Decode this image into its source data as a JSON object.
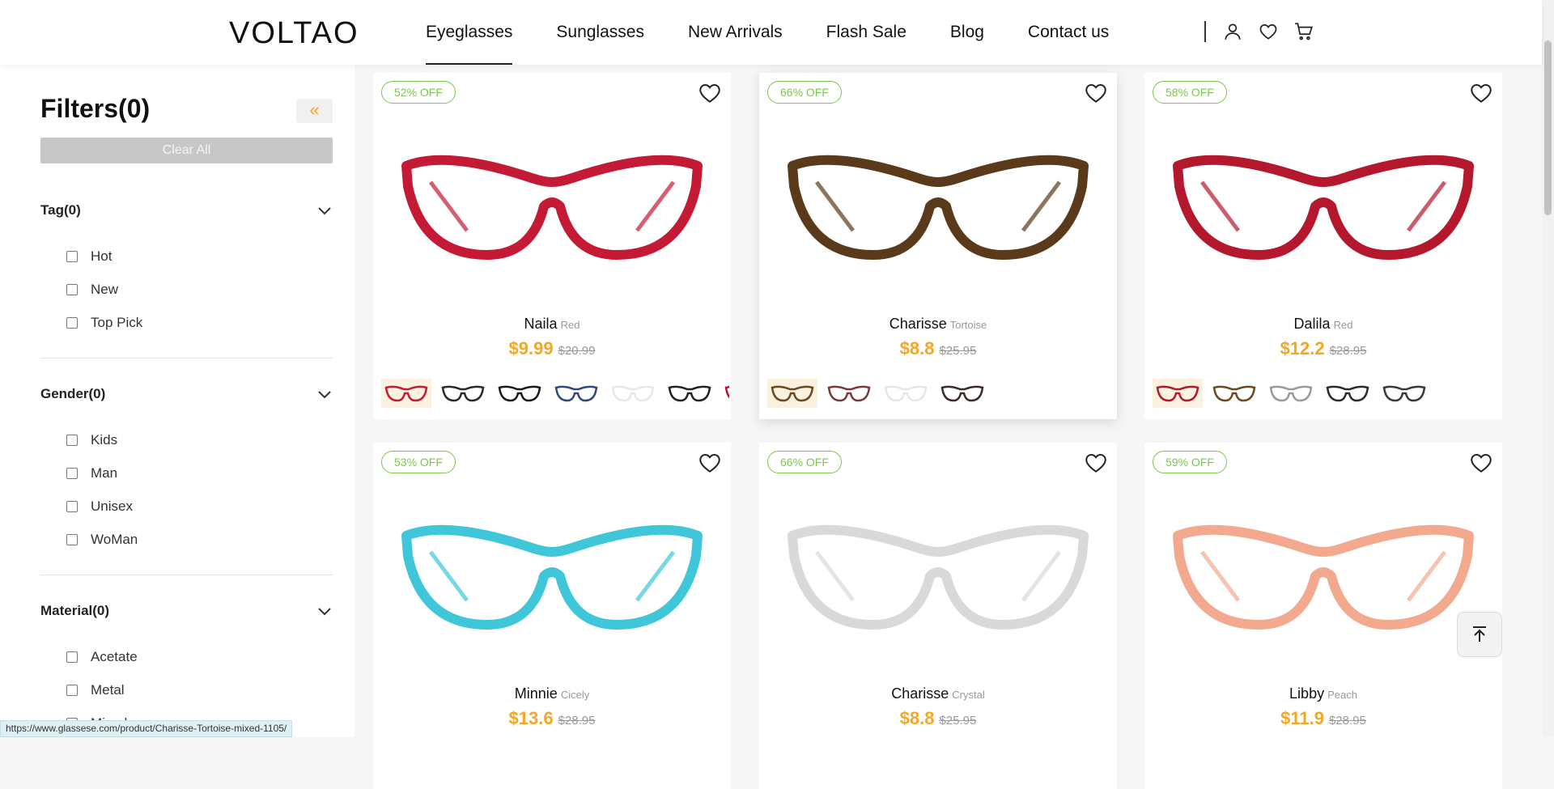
{
  "header": {
    "logo": "VOLTAO",
    "nav": [
      "Eyeglasses",
      "Sunglasses",
      "New Arrivals",
      "Flash Sale",
      "Blog",
      "Contact us"
    ],
    "active_nav": "Eyeglasses",
    "icons": [
      "user-icon",
      "heart-icon",
      "cart-icon"
    ]
  },
  "sidebar": {
    "title": "Filters(0)",
    "collapse_icon": "double-chevron-left-icon",
    "clear_all": "Clear All",
    "groups": [
      {
        "label": "Tag(0)",
        "options": [
          "Hot",
          "New",
          "Top Pick"
        ]
      },
      {
        "label": "Gender(0)",
        "options": [
          "Kids",
          "Man",
          "Unisex",
          "WoMan"
        ]
      },
      {
        "label": "Material(0)",
        "options": [
          "Acetate",
          "Metal",
          "Mixed"
        ]
      }
    ]
  },
  "products": [
    {
      "discount": "52% OFF",
      "name": "Naila",
      "color": "Red",
      "price": "$9.99",
      "old_price": "$20.99",
      "frame_color": "#c41a36",
      "swatches": [
        "#c41a36",
        "#2b2b2b",
        "#1a1a1a",
        "#2f4a7a",
        "#e8e8e8",
        "#222222",
        "#b0182e"
      ]
    },
    {
      "discount": "66% OFF",
      "name": "Charisse",
      "color": "Tortoise",
      "price": "$8.8",
      "old_price": "$25.95",
      "frame_color": "#5a3a1a",
      "swatches": [
        "#6b4a22",
        "#7a3a3a",
        "#e6e6e6",
        "#3a2a2a"
      ]
    },
    {
      "discount": "58% OFF",
      "name": "Dalila",
      "color": "Red",
      "price": "$12.2",
      "old_price": "$28.95",
      "frame_color": "#b5182c",
      "swatches": [
        "#b5182c",
        "#6b4a22",
        "#9a9a9a",
        "#2b2b2b",
        "#3a3a3a"
      ]
    },
    {
      "discount": "53% OFF",
      "name": "Minnie",
      "color": "Cicely",
      "price": "$13.6",
      "old_price": "$28.95",
      "frame_color": "#3fc6d8",
      "swatches": []
    },
    {
      "discount": "66% OFF",
      "name": "Charisse",
      "color": "Crystal",
      "price": "$8.8",
      "old_price": "$25.95",
      "frame_color": "#d9d9d9",
      "swatches": []
    },
    {
      "discount": "59% OFF",
      "name": "Libby",
      "color": "Peach",
      "price": "$11.9",
      "old_price": "$28.95",
      "frame_color": "#f2a98e",
      "swatches": []
    }
  ],
  "scroll_top_icon": "arrow-up-icon",
  "status_url": "https://www.glassese.com/product/Charisse-Tortoise-mixed-1105/"
}
